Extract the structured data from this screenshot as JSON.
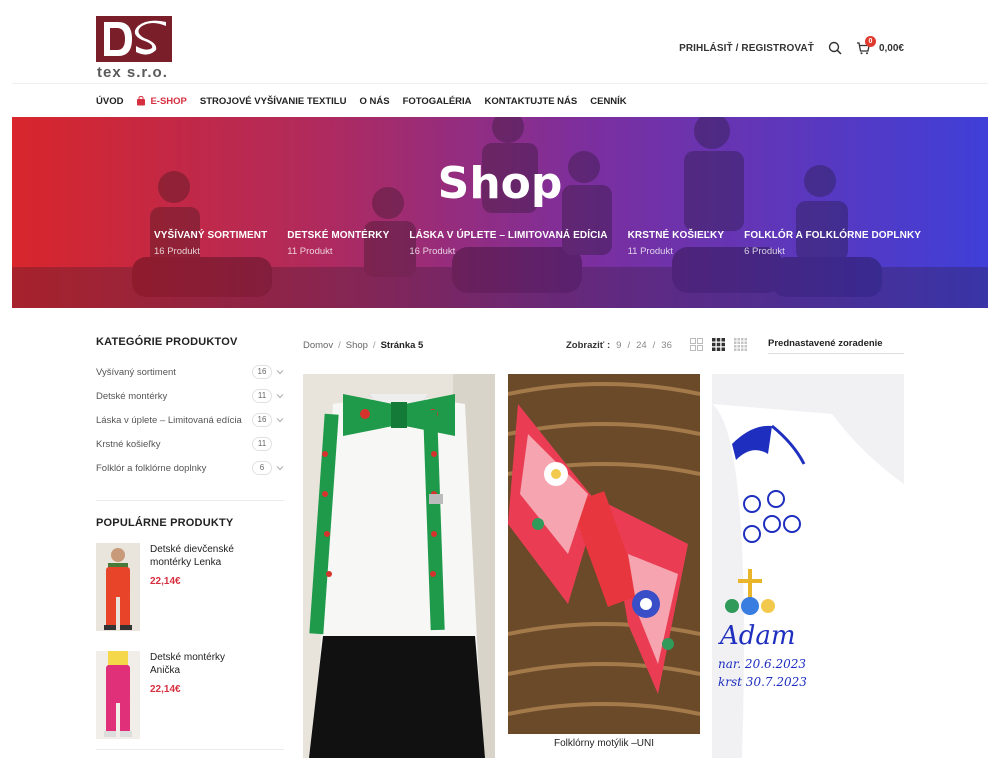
{
  "logo": {
    "text": "tex s.r.o."
  },
  "header": {
    "login_label": "PRIHLÁSIŤ / REGISTROVAŤ",
    "cart_count": "0",
    "cart_total": "0,00€"
  },
  "nav": [
    {
      "label": "ÚVOD"
    },
    {
      "label": "E-SHOP"
    },
    {
      "label": "STROJOVÉ VYŠÍVANIE TEXTILU"
    },
    {
      "label": "O NÁS"
    },
    {
      "label": "FOTOGALÉRIA"
    },
    {
      "label": "KONTAKTUJTE NÁS"
    },
    {
      "label": "CENNÍK"
    }
  ],
  "hero": {
    "title": "Shop",
    "categories": [
      {
        "name": "VYŠÍVANÝ SORTIMENT",
        "count": "16 Produkt"
      },
      {
        "name": "DETSKÉ MONTÉRKY",
        "count": "11 Produkt"
      },
      {
        "name": "LÁSKA V ÚPLETE – LIMITOVANÁ EDÍCIA",
        "count": "16 Produkt"
      },
      {
        "name": "KRSTNÉ KOŠIEĽKY",
        "count": "11 Produkt"
      },
      {
        "name": "FOLKLÓR A FOLKLÓRNE DOPLNKY",
        "count": "6 Produkt"
      }
    ]
  },
  "sidebar": {
    "categories_title": "KATEGÓRIE PRODUKTOV",
    "categories": [
      {
        "name": "Vyšívaný sortiment",
        "count": "16"
      },
      {
        "name": "Detské montérky",
        "count": "11"
      },
      {
        "name": "Láska v úplete – Limitovaná edícia",
        "count": "16"
      },
      {
        "name": "Krstné košieľky",
        "count": "11"
      },
      {
        "name": "Folklór a folklórne doplnky",
        "count": "6"
      }
    ],
    "popular_title": "POPULÁRNE PRODUKTY",
    "popular": [
      {
        "name": "Detské dievčenské montérky Lenka",
        "price": "22,14€"
      },
      {
        "name": "Detské montérky Anička",
        "price": "22,14€"
      }
    ]
  },
  "toolbar": {
    "breadcrumb": {
      "home": "Domov",
      "shop": "Shop",
      "current": "Stránka 5",
      "separator": "/"
    },
    "show_label": "Zobraziť :",
    "per_page": [
      "9",
      "24",
      "36"
    ],
    "per_page_separator": "/",
    "sort_label": "Prednastavené zoradenie"
  },
  "products": [
    {
      "title": ""
    },
    {
      "title": "Folklórny motýlik –UNI"
    },
    {
      "title": ""
    }
  ],
  "colors": {
    "accent": "#d62f3f",
    "hero_left": "#d8262c",
    "hero_right": "#3f3fd8",
    "logo": "#7a1f2a"
  }
}
